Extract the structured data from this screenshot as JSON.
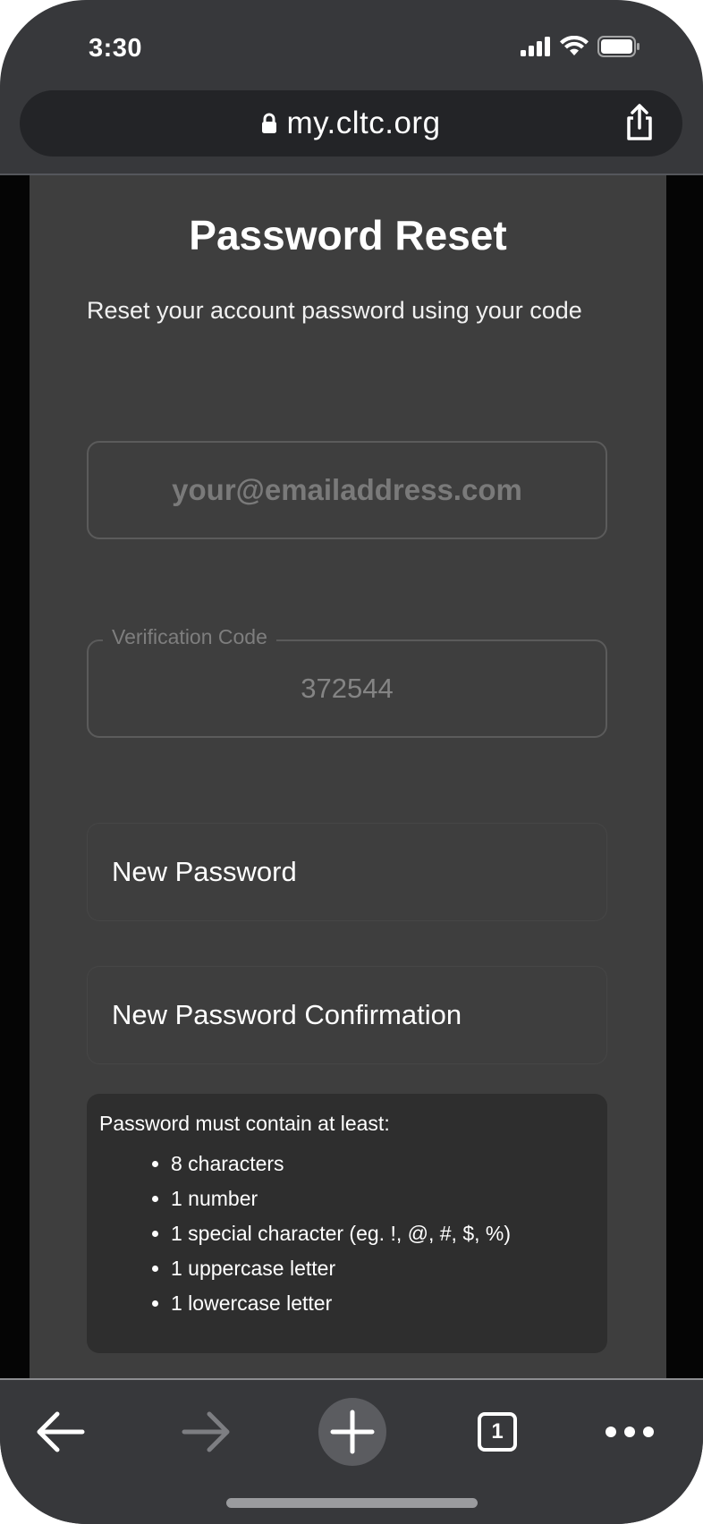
{
  "status_bar": {
    "time": "3:30",
    "icons": [
      "cellular-signal-icon",
      "wifi-icon",
      "battery-icon"
    ]
  },
  "browser": {
    "url": "my.cltc.org",
    "lock_icon": "lock-icon",
    "share_icon": "share-icon",
    "toolbar": {
      "back_icon": "arrow-left-icon",
      "forward_icon": "arrow-right-icon",
      "new_tab_icon": "plus-icon",
      "tab_count": "1",
      "more_icon": "more-dots-icon"
    }
  },
  "page": {
    "title": "Password Reset",
    "subtitle": "Reset your account password using your code",
    "email_placeholder": "your@emailaddress.com",
    "verification_code": {
      "label": "Verification Code",
      "value": "372544"
    },
    "new_password_placeholder": "New Password",
    "new_password_confirmation_placeholder": "New Password Confirmation",
    "requirements": {
      "heading": "Password must contain at least:",
      "items": [
        "8 characters",
        "1 number",
        "1 special character (eg. !, @, #, $, %)",
        "1 uppercase letter",
        "1 lowercase letter"
      ]
    }
  },
  "colors": {
    "chrome_background": "#37383b",
    "address_bar": "#232427",
    "panel_background": "#3e3e3e",
    "requirements_background": "#2e2e2e",
    "page_side_background": "#050505"
  }
}
